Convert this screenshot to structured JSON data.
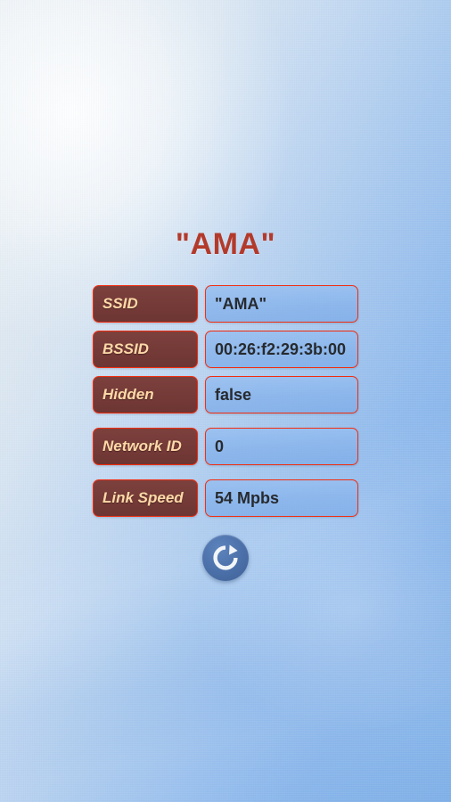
{
  "screen": {
    "title": "\"AMA\"",
    "accent_red": "#b33a2b",
    "label_bg": "#743a37",
    "label_text_color": "#ffd9a8",
    "border_red": "#f12d10",
    "value_bg": "#85b2eb",
    "value_text_color": "#272a2e",
    "button_blue": "#4b6fa8"
  },
  "info": {
    "rows": [
      {
        "label": "SSID",
        "value": "\"AMA\""
      },
      {
        "label": "BSSID",
        "value": "00:26:f2:29:3b:00"
      },
      {
        "label": "Hidden",
        "value": "false"
      },
      {
        "label": "Network ID",
        "value": "0"
      },
      {
        "label": "Link Speed",
        "value": "54 Mpbs"
      }
    ]
  },
  "actions": {
    "refresh_icon": "refresh-icon"
  }
}
